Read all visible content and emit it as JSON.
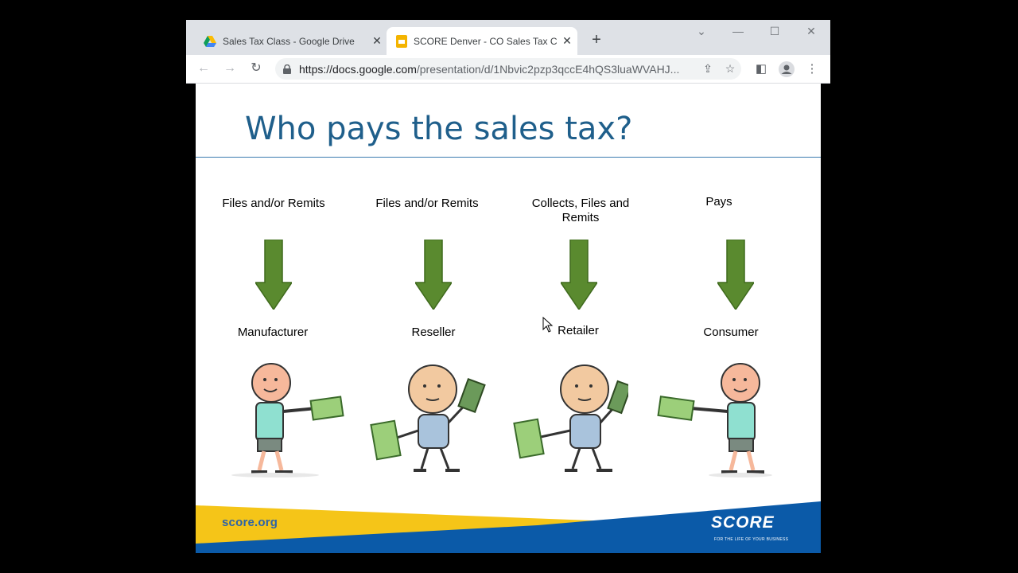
{
  "browser": {
    "tabs": [
      {
        "title": "Sales Tax Class - Google Drive",
        "icon": "google-drive-icon",
        "active": false
      },
      {
        "title": "SCORE Denver - CO Sales Tax Co",
        "icon": "google-slides-icon",
        "active": true
      }
    ],
    "new_tab_glyph": "+",
    "close_glyph": "✕",
    "address": {
      "host": "https://docs.google.com",
      "path": "/presentation/d/1Nbvic2pzp3qccE4hQS3luaWVAHJ..."
    }
  },
  "slide": {
    "title": "Who pays the sales tax?",
    "columns": [
      {
        "role": "Files and/or Remits",
        "entity": "Manufacturer"
      },
      {
        "role": "Files and/or Remits",
        "entity": "Reseller"
      },
      {
        "role": "Collects, Files and Remits",
        "entity": "Retailer"
      },
      {
        "role": "Pays",
        "entity": "Consumer"
      }
    ],
    "footer": {
      "url_text": "score.org",
      "logo_text": "SCORE",
      "tagline": "FOR THE LIFE OF YOUR BUSINESS"
    },
    "colors": {
      "title": "#1f5f8b",
      "arrow": "#5a8a2f",
      "footer_blue": "#0b5aa8",
      "footer_yellow": "#f5c518"
    }
  }
}
